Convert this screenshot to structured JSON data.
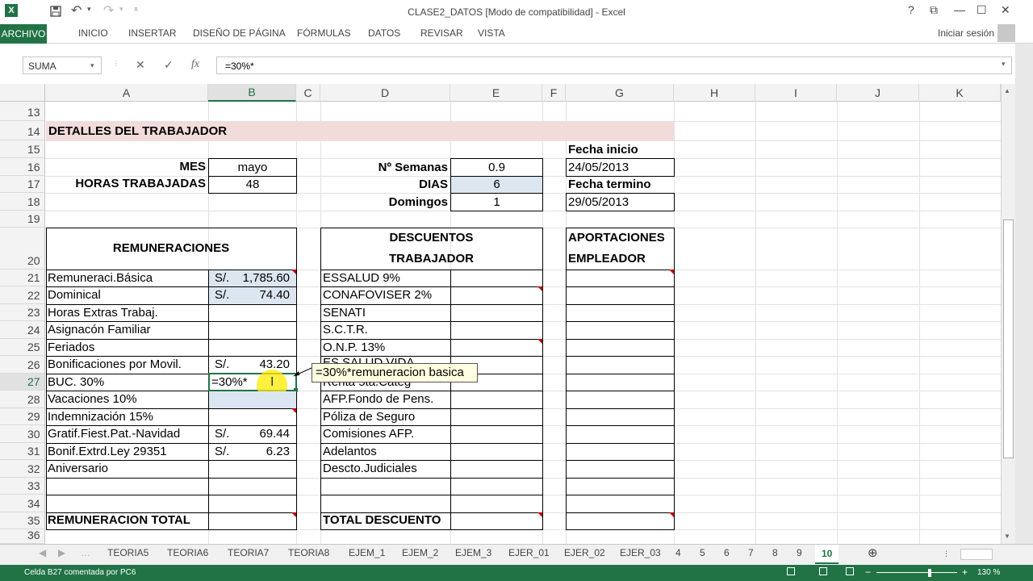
{
  "window": {
    "title": "CLASE2_DATOS  [Modo de compatibilidad] - Excel",
    "help": "?",
    "restore": "⧉",
    "minimize": "—",
    "maximize": "☐",
    "close": "✕"
  },
  "ribbon": {
    "tabs": [
      "ARCHIVO",
      "INICIO",
      "INSERTAR",
      "DISEÑO DE PÁGINA",
      "FÓRMULAS",
      "DATOS",
      "REVISAR",
      "VISTA"
    ],
    "signin": "Iniciar sesión"
  },
  "formula_bar": {
    "name_box": "SUMA",
    "formula": "=30%*",
    "cancel": "✕",
    "enter": "✓",
    "fx": "fx"
  },
  "columns": [
    "A",
    "B",
    "C",
    "D",
    "E",
    "F",
    "G",
    "H",
    "I",
    "J",
    "K"
  ],
  "rows": [
    "13",
    "14",
    "15",
    "16",
    "17",
    "18",
    "19",
    "20",
    "21",
    "22",
    "23",
    "24",
    "25",
    "26",
    "27",
    "28",
    "29",
    "30",
    "31",
    "32",
    "33",
    "34",
    "35",
    "36"
  ],
  "cells": {
    "detalles": "DETALLES DEL TRABAJADOR",
    "mes_label": "MES",
    "mes_value": "mayo",
    "horas_label": "HORAS TRABAJADAS",
    "horas_value": "48",
    "semanas_label": "Nº Semanas",
    "semanas_value": "0.9",
    "dias_label": "DIAS",
    "dias_value": "6",
    "domingos_label": "Domingos",
    "domingos_value": "1",
    "fecha_inicio_label": "Fecha inicio",
    "fecha_inicio_value": "24/05/2013",
    "fecha_termino_label": "Fecha termino",
    "fecha_termino_value": "29/05/2013",
    "remuneraciones_header": "REMUNERACIONES",
    "descuentos_header_1": "DESCUENTOS",
    "descuentos_header_2": "TRABAJADOR",
    "aportaciones_header_1": "APORTACIONES",
    "aportaciones_header_2": "EMPLEADOR",
    "remuneracion_total": "REMUNERACION TOTAL",
    "total_descuento": "TOTAL DESCUENTO",
    "currency": "S/."
  },
  "remuneraciones": [
    {
      "label": "Remuneraci.Básica",
      "currency": "S/.",
      "value": "1,785.60"
    },
    {
      "label": "Dominical",
      "currency": "S/.",
      "value": "74.40"
    },
    {
      "label": "Horas Extras Trabaj.",
      "currency": "",
      "value": ""
    },
    {
      "label": "Asignacón Familiar",
      "currency": "",
      "value": ""
    },
    {
      "label": "Feriados",
      "currency": "",
      "value": ""
    },
    {
      "label": "Bonificaciones por Movil.",
      "currency": "S/.",
      "value": "43.20"
    },
    {
      "label": "BUC. 30%",
      "currency": "",
      "value": "=30%*"
    },
    {
      "label": "Vacaciones 10%",
      "currency": "",
      "value": ""
    },
    {
      "label": "Indemnización 15%",
      "currency": "",
      "value": ""
    },
    {
      "label": "Gratif.Fiest.Pat.-Navidad",
      "currency": "S/.",
      "value": "69.44"
    },
    {
      "label": "Bonif.Extrd.Ley 29351",
      "currency": "S/.",
      "value": "6.23"
    },
    {
      "label": "Aniversario",
      "currency": "",
      "value": ""
    }
  ],
  "descuentos": [
    "ESSALUD 9%",
    "CONAFOVISER 2%",
    "SENATI",
    "S.C.T.R.",
    "O.N.P. 13%",
    "ES SALUD VIDA",
    "Renta 5ta.Categ",
    "AFP.Fondo de Pens.",
    "Póliza de Seguro",
    "Comisiones AFP.",
    "Adelantos",
    "Descto.Judiciales"
  ],
  "comment": "=30%*remuneracion basica",
  "sheets": [
    "TEORIA5",
    "TEORIA6",
    "TEORIA7",
    "TEORIA8",
    "EJEM_1",
    "EJEM_2",
    "EJEM_3",
    "EJER_01",
    "EJER_02",
    "EJER_03",
    "4",
    "5",
    "6",
    "7",
    "8",
    "9",
    "10"
  ],
  "active_sheet": "10",
  "status": {
    "text": "Celda B27 comentada por PC6",
    "zoom": "130 %",
    "zoom_minus": "−",
    "zoom_plus": "+"
  },
  "accent_color": "#217346"
}
